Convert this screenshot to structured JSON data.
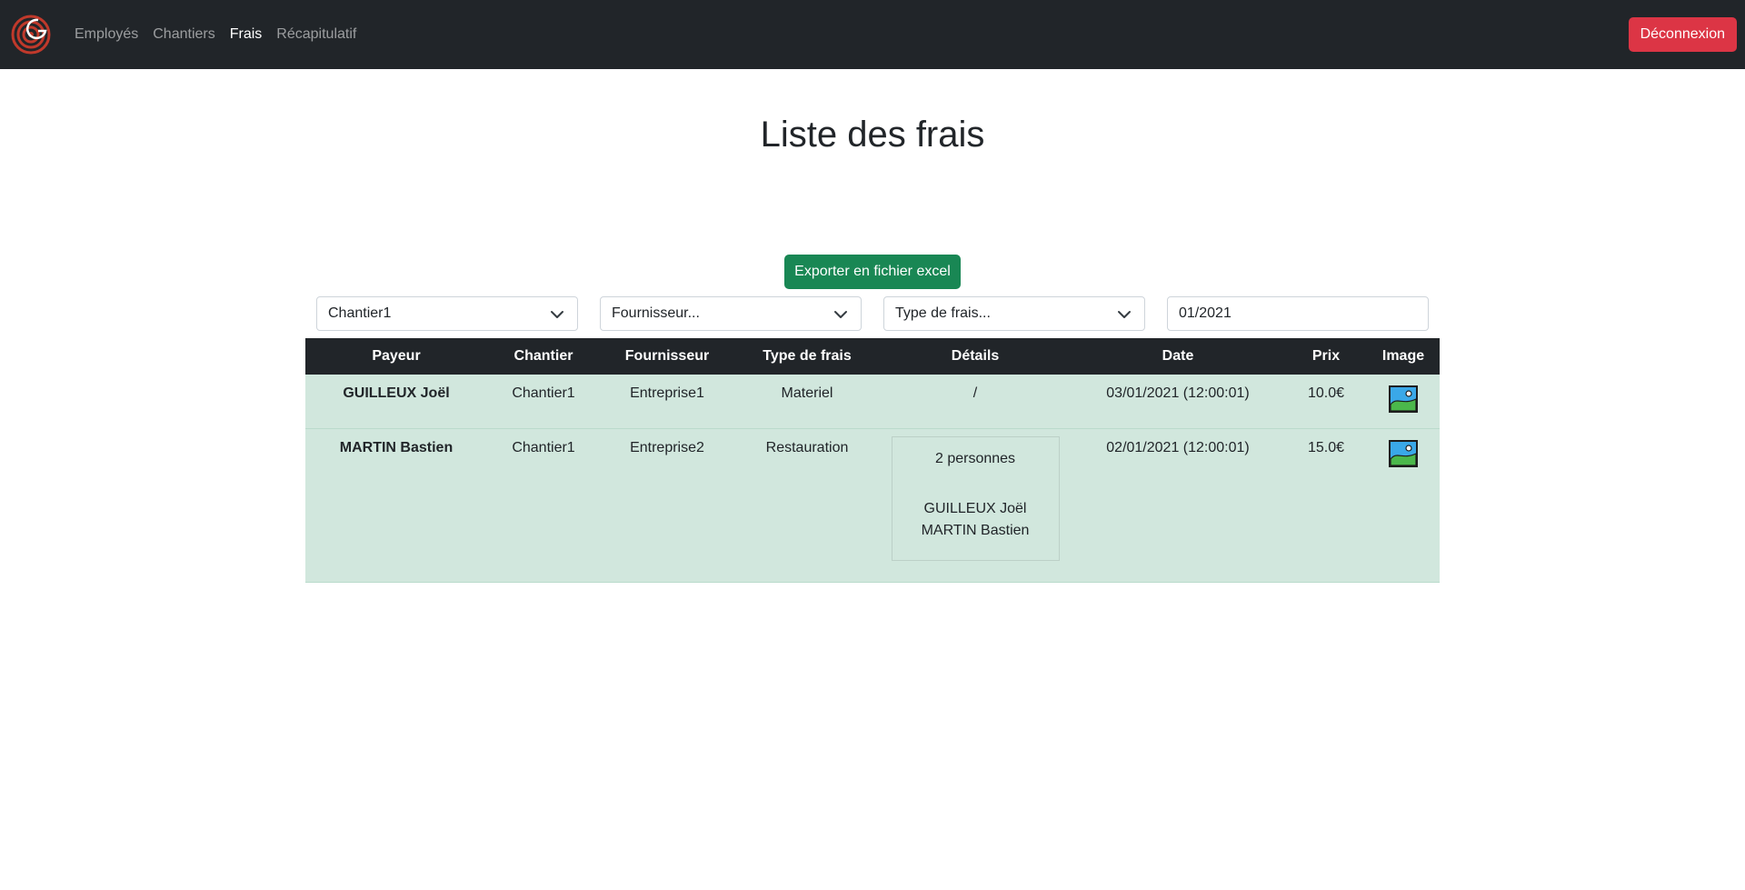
{
  "nav": {
    "links": [
      {
        "label": "Employés",
        "active": false
      },
      {
        "label": "Chantiers",
        "active": false
      },
      {
        "label": "Frais",
        "active": true
      },
      {
        "label": "Récapitulatif",
        "active": false
      }
    ],
    "logout_label": "Déconnexion"
  },
  "page_title": "Liste des frais",
  "export_label": "Exporter en fichier excel",
  "filters": {
    "chantier": "Chantier1",
    "fournisseur": "Fournisseur...",
    "type_frais": "Type de frais...",
    "month": "01/2021"
  },
  "table": {
    "headers": [
      "Payeur",
      "Chantier",
      "Fournisseur",
      "Type de frais",
      "Détails",
      "Date",
      "Prix",
      "Image"
    ],
    "rows": [
      {
        "payeur": "GUILLEUX Joël",
        "chantier": "Chantier1",
        "fournisseur": "Entreprise1",
        "type": "Materiel",
        "details": "/",
        "date": "03/01/2021 (12:00:01)",
        "prix": "10.0€"
      },
      {
        "payeur": "MARTIN Bastien",
        "chantier": "Chantier1",
        "fournisseur": "Entreprise2",
        "type": "Restauration",
        "details_count": "2 personnes",
        "details_people": [
          "GUILLEUX Joël",
          "MARTIN Bastien"
        ],
        "date": "02/01/2021 (12:00:01)",
        "prix": "15.0€"
      }
    ]
  },
  "colors": {
    "navbar": "#212529",
    "danger": "#dc3545",
    "success": "#198754",
    "row_success": "#d1e7dd"
  },
  "icons": [
    "app-logo",
    "chevron-down-icon",
    "image-icon"
  ]
}
